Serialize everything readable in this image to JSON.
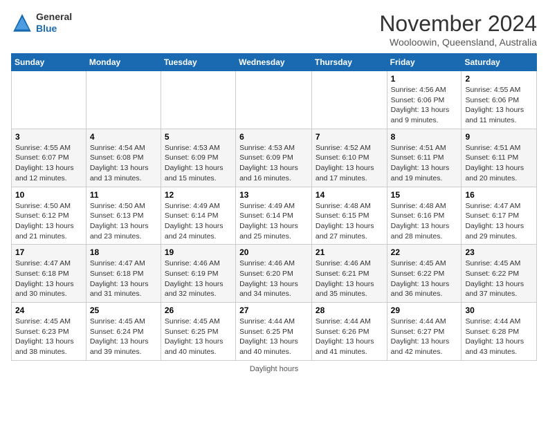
{
  "header": {
    "logo_general": "General",
    "logo_blue": "Blue",
    "month_title": "November 2024",
    "location": "Wooloowin, Queensland, Australia"
  },
  "days_of_week": [
    "Sunday",
    "Monday",
    "Tuesday",
    "Wednesday",
    "Thursday",
    "Friday",
    "Saturday"
  ],
  "weeks": [
    [
      {
        "day": "",
        "info": ""
      },
      {
        "day": "",
        "info": ""
      },
      {
        "day": "",
        "info": ""
      },
      {
        "day": "",
        "info": ""
      },
      {
        "day": "",
        "info": ""
      },
      {
        "day": "1",
        "info": "Sunrise: 4:56 AM\nSunset: 6:06 PM\nDaylight: 13 hours and 9 minutes."
      },
      {
        "day": "2",
        "info": "Sunrise: 4:55 AM\nSunset: 6:06 PM\nDaylight: 13 hours and 11 minutes."
      }
    ],
    [
      {
        "day": "3",
        "info": "Sunrise: 4:55 AM\nSunset: 6:07 PM\nDaylight: 13 hours and 12 minutes."
      },
      {
        "day": "4",
        "info": "Sunrise: 4:54 AM\nSunset: 6:08 PM\nDaylight: 13 hours and 13 minutes."
      },
      {
        "day": "5",
        "info": "Sunrise: 4:53 AM\nSunset: 6:09 PM\nDaylight: 13 hours and 15 minutes."
      },
      {
        "day": "6",
        "info": "Sunrise: 4:53 AM\nSunset: 6:09 PM\nDaylight: 13 hours and 16 minutes."
      },
      {
        "day": "7",
        "info": "Sunrise: 4:52 AM\nSunset: 6:10 PM\nDaylight: 13 hours and 17 minutes."
      },
      {
        "day": "8",
        "info": "Sunrise: 4:51 AM\nSunset: 6:11 PM\nDaylight: 13 hours and 19 minutes."
      },
      {
        "day": "9",
        "info": "Sunrise: 4:51 AM\nSunset: 6:11 PM\nDaylight: 13 hours and 20 minutes."
      }
    ],
    [
      {
        "day": "10",
        "info": "Sunrise: 4:50 AM\nSunset: 6:12 PM\nDaylight: 13 hours and 21 minutes."
      },
      {
        "day": "11",
        "info": "Sunrise: 4:50 AM\nSunset: 6:13 PM\nDaylight: 13 hours and 23 minutes."
      },
      {
        "day": "12",
        "info": "Sunrise: 4:49 AM\nSunset: 6:14 PM\nDaylight: 13 hours and 24 minutes."
      },
      {
        "day": "13",
        "info": "Sunrise: 4:49 AM\nSunset: 6:14 PM\nDaylight: 13 hours and 25 minutes."
      },
      {
        "day": "14",
        "info": "Sunrise: 4:48 AM\nSunset: 6:15 PM\nDaylight: 13 hours and 27 minutes."
      },
      {
        "day": "15",
        "info": "Sunrise: 4:48 AM\nSunset: 6:16 PM\nDaylight: 13 hours and 28 minutes."
      },
      {
        "day": "16",
        "info": "Sunrise: 4:47 AM\nSunset: 6:17 PM\nDaylight: 13 hours and 29 minutes."
      }
    ],
    [
      {
        "day": "17",
        "info": "Sunrise: 4:47 AM\nSunset: 6:18 PM\nDaylight: 13 hours and 30 minutes."
      },
      {
        "day": "18",
        "info": "Sunrise: 4:47 AM\nSunset: 6:18 PM\nDaylight: 13 hours and 31 minutes."
      },
      {
        "day": "19",
        "info": "Sunrise: 4:46 AM\nSunset: 6:19 PM\nDaylight: 13 hours and 32 minutes."
      },
      {
        "day": "20",
        "info": "Sunrise: 4:46 AM\nSunset: 6:20 PM\nDaylight: 13 hours and 34 minutes."
      },
      {
        "day": "21",
        "info": "Sunrise: 4:46 AM\nSunset: 6:21 PM\nDaylight: 13 hours and 35 minutes."
      },
      {
        "day": "22",
        "info": "Sunrise: 4:45 AM\nSunset: 6:22 PM\nDaylight: 13 hours and 36 minutes."
      },
      {
        "day": "23",
        "info": "Sunrise: 4:45 AM\nSunset: 6:22 PM\nDaylight: 13 hours and 37 minutes."
      }
    ],
    [
      {
        "day": "24",
        "info": "Sunrise: 4:45 AM\nSunset: 6:23 PM\nDaylight: 13 hours and 38 minutes."
      },
      {
        "day": "25",
        "info": "Sunrise: 4:45 AM\nSunset: 6:24 PM\nDaylight: 13 hours and 39 minutes."
      },
      {
        "day": "26",
        "info": "Sunrise: 4:45 AM\nSunset: 6:25 PM\nDaylight: 13 hours and 40 minutes."
      },
      {
        "day": "27",
        "info": "Sunrise: 4:44 AM\nSunset: 6:25 PM\nDaylight: 13 hours and 40 minutes."
      },
      {
        "day": "28",
        "info": "Sunrise: 4:44 AM\nSunset: 6:26 PM\nDaylight: 13 hours and 41 minutes."
      },
      {
        "day": "29",
        "info": "Sunrise: 4:44 AM\nSunset: 6:27 PM\nDaylight: 13 hours and 42 minutes."
      },
      {
        "day": "30",
        "info": "Sunrise: 4:44 AM\nSunset: 6:28 PM\nDaylight: 13 hours and 43 minutes."
      }
    ]
  ],
  "footer": {
    "daylight_label": "Daylight hours"
  }
}
